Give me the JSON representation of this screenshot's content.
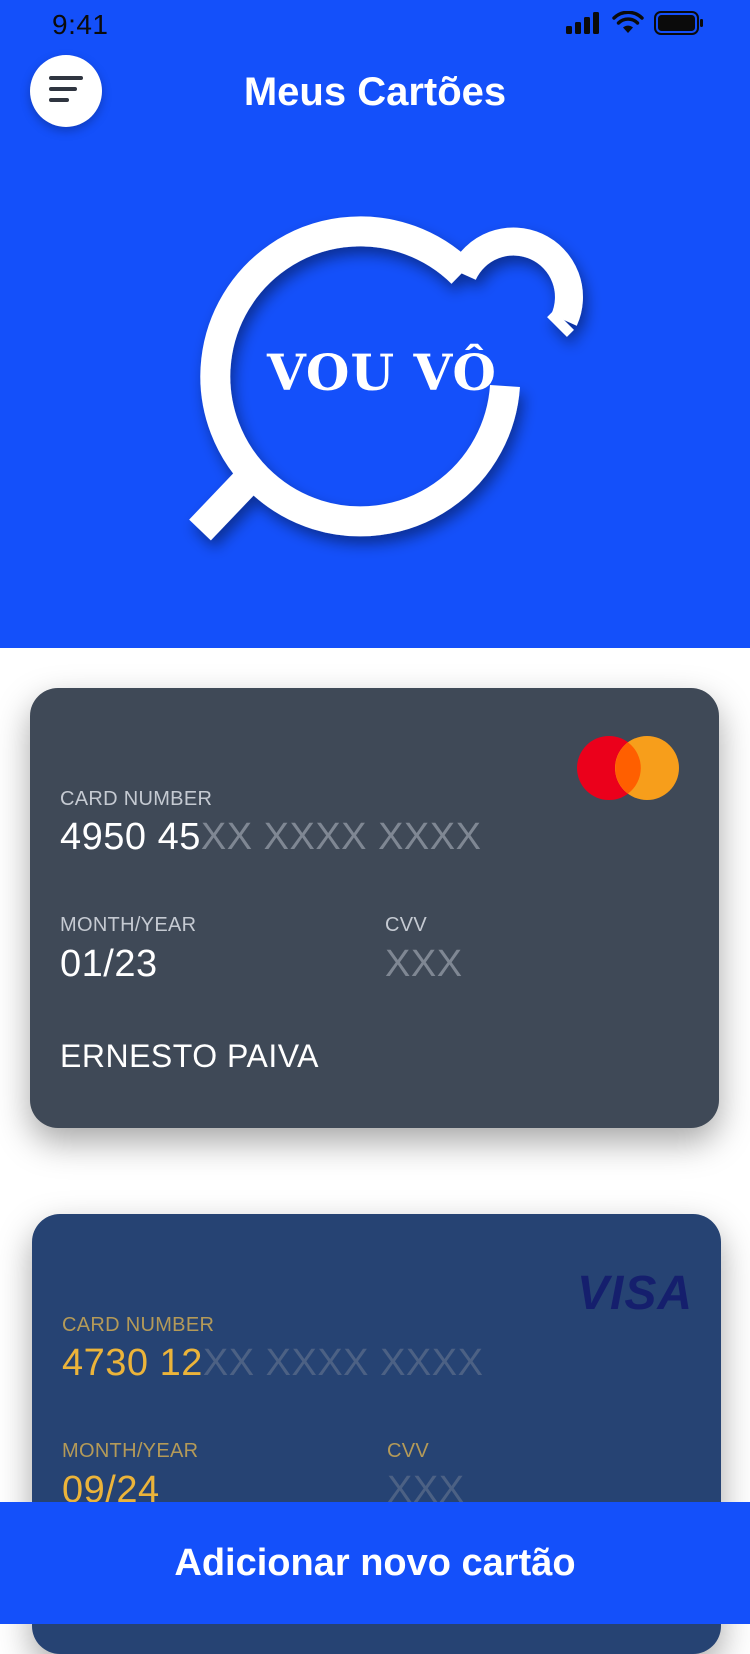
{
  "status_bar": {
    "time": "9:41",
    "icons": [
      "cellular-signal-icon",
      "wifi-icon",
      "battery-icon"
    ]
  },
  "header": {
    "menu_icon": "hamburger-menu-icon",
    "title": "Meus Cartões",
    "logo_text": "VOU VÔ",
    "background_color": "#1450FA"
  },
  "cards": [
    {
      "brand": "mastercard",
      "number_label": "CARD NUMBER",
      "number_visible": "4950 45",
      "number_masked": "XX XXXX XXXX",
      "month_label": "MONTH/YEAR",
      "month_value": "01/23",
      "cvv_label": "CVV",
      "cvv_value": "XXX",
      "holder": "ERNESTO PAIVA",
      "background_color": "#3F4957"
    },
    {
      "brand": "VISA",
      "number_label": "CARD NUMBER",
      "number_visible": "4730 12",
      "number_masked": "XX XXXX XXXX",
      "month_label": "MONTH/YEAR",
      "month_value": "09/24",
      "cvv_label": "CVV",
      "cvv_value": "XXX",
      "background_color": "#264373"
    }
  ],
  "actions": {
    "add_card_label": "Adicionar novo cartão"
  }
}
